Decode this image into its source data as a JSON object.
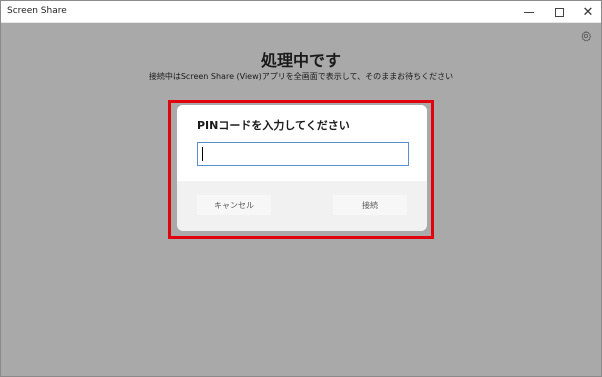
{
  "window": {
    "title": "Screen Share",
    "controls": {
      "minimize": "minimize-icon",
      "maximize": "maximize-icon",
      "close": "✕"
    }
  },
  "main": {
    "heading": "処理中です",
    "subheading": "接続中はScreen Share (View)アプリを全画面で表示して、そのままお待ちください",
    "settings_icon": "gear-icon"
  },
  "dialog": {
    "title": "PINコードを入力してください",
    "pin_value": "",
    "cancel_label": "キャンセル",
    "connect_label": "接続"
  },
  "colors": {
    "overlay": "#a9a9a9",
    "highlight_border": "#e0000e",
    "input_border": "#5a8fcf"
  }
}
